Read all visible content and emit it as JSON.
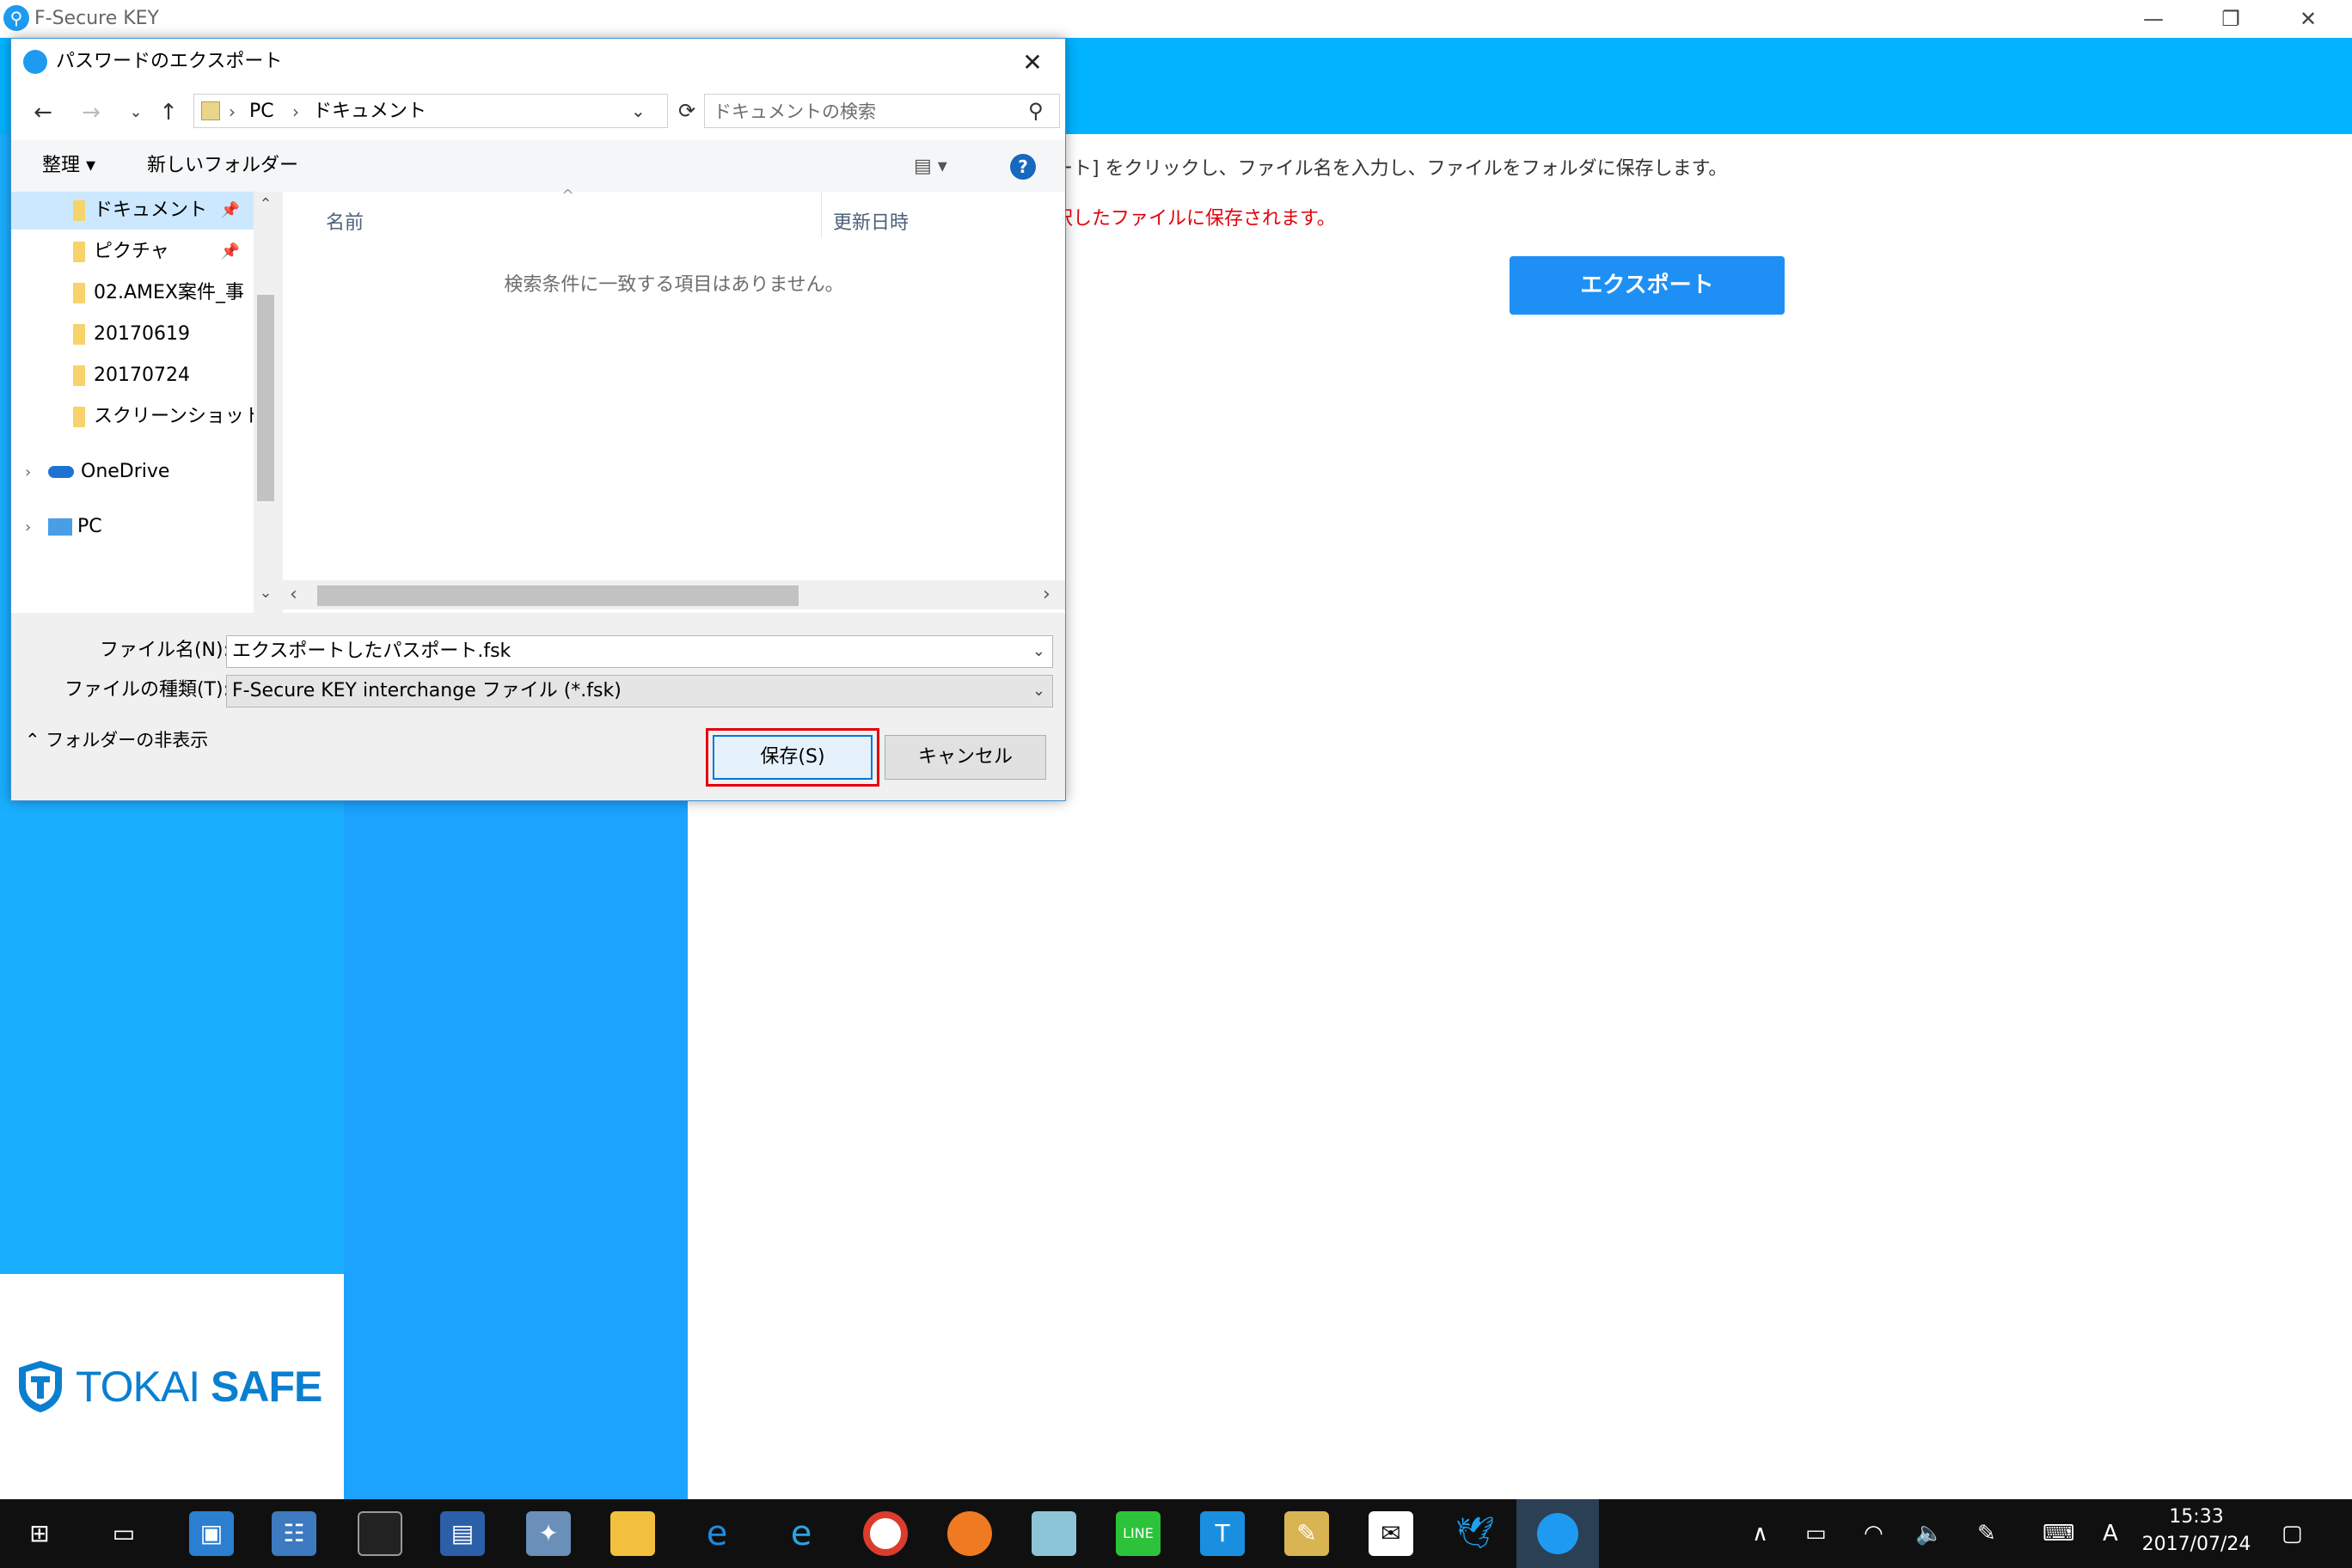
{
  "app": {
    "title": "F-Secure KEY",
    "window_controls": {
      "minimize": "—",
      "restore": "❐",
      "close": "✕"
    },
    "instruction": "ート] をクリックし、ファイル名を入力し、ファイルをフォルダに保存します。",
    "note": "択したファイルに保存されます。",
    "export_button": "エクスポート",
    "logo": {
      "tokai": "TOKAI",
      "safe": "SAFE"
    },
    "colors": {
      "header": "#02b3ff",
      "panel": "#1ca2ff",
      "note": "#e3000b"
    }
  },
  "dialog": {
    "title": "パスワードのエクスポート",
    "close": "✕",
    "nav": {
      "back": "←",
      "forward": "→",
      "recent": "⌄",
      "up": "↑"
    },
    "address": {
      "pc": "PC",
      "folder": "ドキュメント",
      "sep": "›",
      "dropdown": "⌄"
    },
    "refresh": "⟳",
    "search_placeholder": "ドキュメントの検索",
    "toolbar": {
      "organize": "整理 ▾",
      "new_folder": "新しいフォルダー",
      "view": "▤ ▾",
      "help": "?"
    },
    "sidebar": {
      "items": [
        {
          "label": "ドキュメント",
          "pinned": "📌"
        },
        {
          "label": "ピクチャ",
          "pinned": "📌"
        },
        {
          "label": "02.AMEX案件_事"
        },
        {
          "label": "20170619"
        },
        {
          "label": "20170724"
        },
        {
          "label": "スクリーンショット"
        },
        {
          "label": "OneDrive",
          "expand": "›"
        },
        {
          "label": "PC",
          "expand": "›"
        }
      ],
      "scroll_up": "⌃",
      "scroll_down": "⌄"
    },
    "files": {
      "col_name": "名前",
      "col_date": "更新日時",
      "sort_arrow": "^",
      "empty": "検索条件に一致する項目はありません。",
      "scroll_left": "‹",
      "scroll_right": "›"
    },
    "form": {
      "filename_label": "ファイル名(N):",
      "filename_value": "エクスポートしたパスポート.fsk",
      "filetype_label": "ファイルの種類(T):",
      "filetype_value": "F-Secure KEY interchange ファイル (*.fsk)",
      "dd": "⌄"
    },
    "toggle_folders": "⌃ フォルダーの非表示",
    "save": "保存(S)",
    "cancel": "キャンセル"
  },
  "taskbar": {
    "tray": {
      "overflow": "∧",
      "battery": "▭",
      "wifi": "◠",
      "volume": "🔈",
      "pen": "✎",
      "keyboard": "⌨",
      "ime": "A",
      "notifications": "▢"
    },
    "time": "15:33",
    "date": "2017/07/24"
  }
}
